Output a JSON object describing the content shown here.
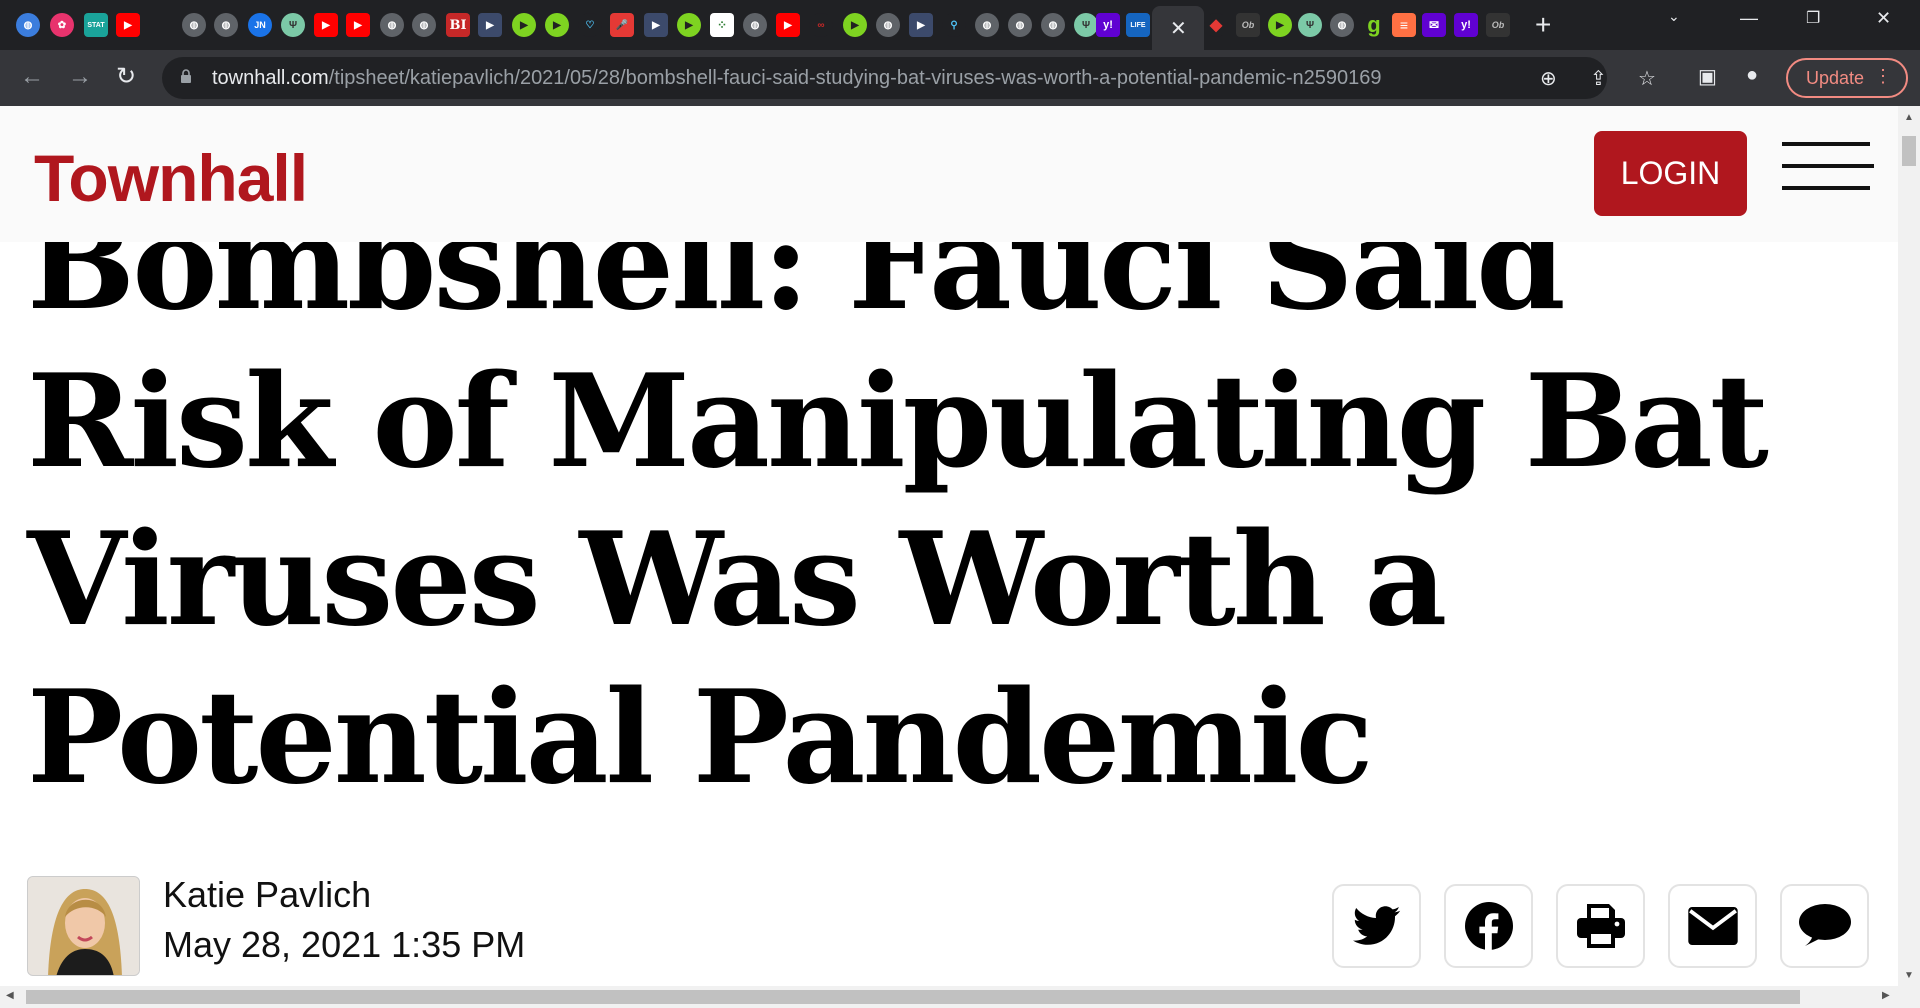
{
  "browser": {
    "tabs_favicons": [
      "globe-icon",
      "pinwheel-icon",
      "stat-icon",
      "youtube-icon",
      "globe-icon",
      "globe-icon",
      "jn-icon",
      "trident-icon",
      "youtube-icon",
      "youtube-icon",
      "globe-icon",
      "globe-icon",
      "bi-icon",
      "flag-icon",
      "play-icon",
      "play-icon",
      "shield-icon",
      "mic-icon",
      "flag-icon",
      "play-icon",
      "dots-icon",
      "globe-icon",
      "youtube-icon",
      "link-icon",
      "play-icon",
      "globe-icon",
      "flag-icon",
      "search-icon",
      "globe-icon",
      "globe-icon",
      "globe-icon",
      "trident-icon",
      "yahoo-icon",
      "life-icon"
    ],
    "stat_label": "STAT",
    "jn_label": "JN",
    "bi_label": "BI",
    "yahoo_label": "y!",
    "life_label": "LIFE",
    "g_label": "g",
    "active_tab_close": "✕",
    "new_tab": "+",
    "url_host": "townhall.com",
    "url_path": "/tipsheet/katiepavlich/2021/05/28/bombshell-fauci-said-studying-bat-viruses-was-worth-a-potential-pandemic-n2590169",
    "update_label": "Update"
  },
  "site": {
    "logo": "Townhall",
    "login_label": "LOGIN"
  },
  "article": {
    "headline": "Bombshell: Fauci Said Risk of Manipulating Bat Viruses Was Worth a Potential Pandemic",
    "author": "Katie Pavlich",
    "date": "May 28, 2021 1:35 PM"
  },
  "share": [
    "twitter-icon",
    "facebook-icon",
    "print-icon",
    "email-icon",
    "comment-icon"
  ],
  "colors": {
    "brand": "#b0171e",
    "browser_dark": "#202124",
    "toolbar": "#35363a"
  }
}
